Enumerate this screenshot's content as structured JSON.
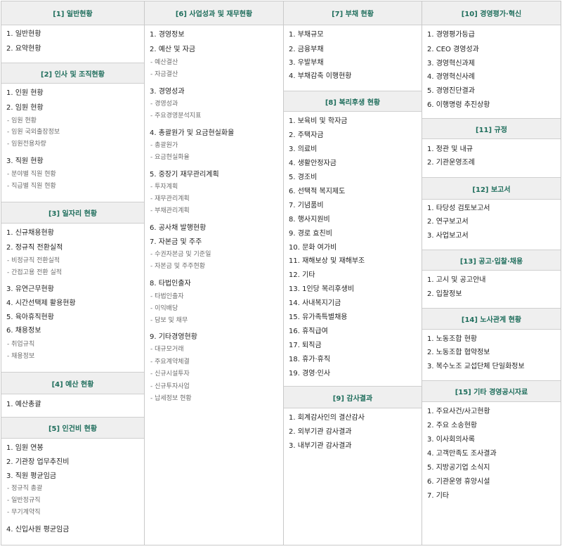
{
  "sections": [
    {
      "title": "[1] 일반현황",
      "items": [
        {
          "label": "1. 일반현황"
        },
        {
          "label": "2. 요약현황"
        }
      ]
    },
    {
      "title": "[2] 인사 및 조직현황",
      "items": [
        {
          "label": "1. 인원 현황"
        },
        {
          "label": "2. 임원 현황",
          "subs": [
            "- 임원 현황",
            "- 임원 국외출장정보",
            "- 임원전용차량"
          ]
        },
        {
          "label": "3. 직원 현황",
          "subs": [
            "- 분야별 직원 현황",
            "- 직급별 직원 현황"
          ]
        }
      ]
    },
    {
      "title": "[3] 일자리 현황",
      "items": [
        {
          "label": "1. 신규채용현황"
        },
        {
          "label": "2. 정규직 전환실적",
          "subs": [
            "- 비정규직 전환실적",
            "- 간접고용 전환 실적"
          ]
        },
        {
          "label": "3. 유연근무현황"
        },
        {
          "label": "4. 시간선택제 활용현황"
        },
        {
          "label": "5. 육아휴직현황"
        },
        {
          "label": "6. 채용정보",
          "subs": [
            "- 취업규칙",
            "- 채용정보"
          ]
        }
      ]
    },
    {
      "title": "[4] 예산 현황",
      "items": [
        {
          "label": "1. 예산총괄"
        }
      ]
    },
    {
      "title": "[5] 인건비 현황",
      "items": [
        {
          "label": "1. 임원 연봉"
        },
        {
          "label": "2. 기관장 업무추진비"
        },
        {
          "label": "3. 직원 평균임금",
          "subs": [
            "- 정규직 총괄",
            "- 일반정규직",
            "- 무기계약직"
          ]
        },
        {
          "label": "4. 신입사원 평균임금"
        }
      ]
    },
    {
      "title": "[6] 사업성과 및 재무현황",
      "items": [
        {
          "label": "1. 경영정보"
        },
        {
          "label": "2. 예산 및 자금",
          "subs": [
            "- 예산결산",
            "- 자금결산"
          ]
        },
        {
          "label": "3. 경영성과",
          "subs": [
            "- 경영성과",
            "- 주요경영분석지표"
          ]
        },
        {
          "label": "4. 총괄원가 및 요금현실화율",
          "subs": [
            "- 총괄원가",
            "- 요금현실화율"
          ]
        },
        {
          "label": "5. 중장기 재무관리계획",
          "subs": [
            "- 투자계획",
            "- 재무관리계획",
            "- 부채관리계획"
          ]
        },
        {
          "label": "6. 공사채 발행현황"
        },
        {
          "label": "7. 자본금 및 주주",
          "subs": [
            "- 수권자본금 및 기준일",
            "- 자본금 및 주주현황"
          ]
        },
        {
          "label": "8. 타법인출자",
          "subs": [
            "- 타법인출자",
            "- 이익배당",
            "- 담보 및 채무"
          ]
        },
        {
          "label": "9. 기타경영현황",
          "subs": [
            "- 대규모거래",
            "- 주요계약체결",
            "- 신규시설투자",
            "- 신규투자사업",
            "- 납세정보 현황"
          ]
        }
      ]
    },
    {
      "title": "[7] 부채 현황",
      "items": [
        {
          "label": "1. 부채규모"
        },
        {
          "label": "2. 금융부채"
        },
        {
          "label": "3. 우발부채"
        },
        {
          "label": "4. 부채감축 이행현황"
        }
      ]
    },
    {
      "title": "[8] 복리후생 현황",
      "items": [
        {
          "label": "1. 보육비 및 학자금"
        },
        {
          "label": "2. 주택자금"
        },
        {
          "label": "3. 의료비"
        },
        {
          "label": "4. 생활안정자금"
        },
        {
          "label": "5. 경조비"
        },
        {
          "label": "6. 선택적 복지제도"
        },
        {
          "label": "7. 기념품비"
        },
        {
          "label": "8. 행사지원비"
        },
        {
          "label": "9. 경로 효친비"
        },
        {
          "label": "10. 문화 여가비"
        },
        {
          "label": "11. 재해보상 및 재해부조"
        },
        {
          "label": "12. 기타"
        },
        {
          "label": "13. 1인당 복리후생비"
        },
        {
          "label": "14. 사내복지기금"
        },
        {
          "label": "15. 유가족특별채용"
        },
        {
          "label": "16. 휴직급여"
        },
        {
          "label": "17. 퇴직금"
        },
        {
          "label": "18. 휴가·휴직"
        },
        {
          "label": "19. 경영·인사"
        }
      ]
    },
    {
      "title": "[9] 감사결과",
      "items": [
        {
          "label": "1. 회계감사인의 결산감사"
        },
        {
          "label": "2. 외부기관 감사결과"
        },
        {
          "label": "3. 내부기관 감사결과"
        }
      ]
    },
    {
      "title": "[10] 경영평가·혁신",
      "items": [
        {
          "label": "1. 경영평가등급"
        },
        {
          "label": "2. CEO 경영성과"
        },
        {
          "label": "3. 경영혁신과제"
        },
        {
          "label": "4. 경영혁신사례"
        },
        {
          "label": "5. 경영진단결과"
        },
        {
          "label": "6. 이행명령 추진상황"
        }
      ]
    },
    {
      "title": "[11] 규정",
      "items": [
        {
          "label": "1. 정관 및 내규"
        },
        {
          "label": "2. 기관운영조례"
        }
      ]
    },
    {
      "title": "[12] 보고서",
      "items": [
        {
          "label": "1. 타당성 검토보고서"
        },
        {
          "label": "2. 연구보고서"
        },
        {
          "label": "3. 사업보고서"
        }
      ]
    },
    {
      "title": "[13] 공고·입찰·채용",
      "items": [
        {
          "label": "1. 고시 및 공고안내"
        },
        {
          "label": "2. 입찰정보"
        }
      ]
    },
    {
      "title": "[14] 노사관계 현황",
      "items": [
        {
          "label": "1. 노동조합 현황"
        },
        {
          "label": "2. 노동조합 협약정보"
        },
        {
          "label": "3. 복수노조 교섭단체 단일화정보"
        }
      ]
    },
    {
      "title": "[15] 기타 경영공시자료",
      "items": [
        {
          "label": "1. 주요사건/사고현황"
        },
        {
          "label": "2. 주요 소송현황"
        },
        {
          "label": "3. 이사회의사록"
        },
        {
          "label": "4. 고객만족도 조사결과"
        },
        {
          "label": "5. 지방공기업 소식지"
        },
        {
          "label": "6. 기관운영 휴양시설"
        },
        {
          "label": "7. 기타"
        }
      ]
    }
  ]
}
